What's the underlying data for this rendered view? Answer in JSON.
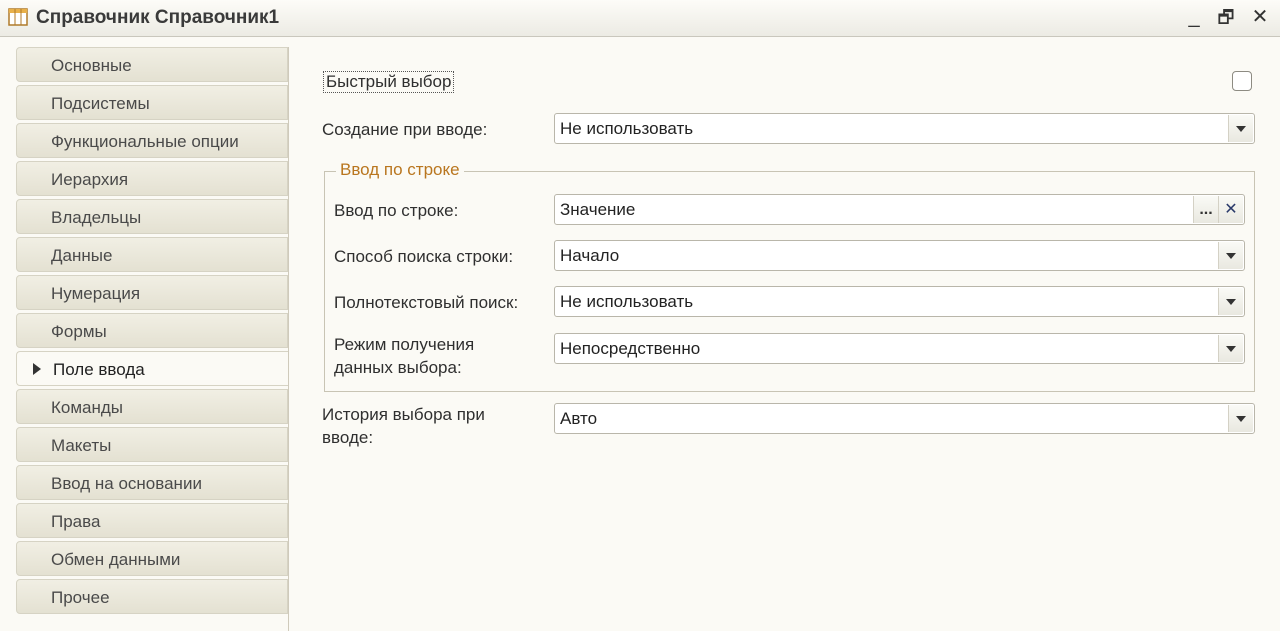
{
  "window": {
    "title": "Справочник Справочник1",
    "controls": {
      "minimize": "_",
      "restore": "🗗",
      "close": "✕"
    }
  },
  "tabs": [
    {
      "label": "Основные",
      "active": false
    },
    {
      "label": "Подсистемы",
      "active": false
    },
    {
      "label": "Функциональные опции",
      "active": false
    },
    {
      "label": "Иерархия",
      "active": false
    },
    {
      "label": "Владельцы",
      "active": false
    },
    {
      "label": "Данные",
      "active": false
    },
    {
      "label": "Нумерация",
      "active": false
    },
    {
      "label": "Формы",
      "active": false
    },
    {
      "label": "Поле ввода",
      "active": true
    },
    {
      "label": "Команды",
      "active": false
    },
    {
      "label": "Макеты",
      "active": false
    },
    {
      "label": "Ввод на основании",
      "active": false
    },
    {
      "label": "Права",
      "active": false
    },
    {
      "label": "Обмен данными",
      "active": false
    },
    {
      "label": "Прочее",
      "active": false
    }
  ],
  "form": {
    "quick_choice": {
      "label": "Быстрый выбор",
      "checked": false
    },
    "create_on_input": {
      "label": "Создание при вводе:",
      "value": "Не использовать"
    },
    "input_by_string_group": {
      "title": "Ввод по строке",
      "input_by_string": {
        "label": "Ввод по строке:",
        "value": "Значение",
        "select_btn": "...",
        "clear_btn": "✕"
      },
      "search_mode": {
        "label": "Способ поиска строки:",
        "value": "Начало"
      },
      "fulltext_search": {
        "label": "Полнотекстовый поиск:",
        "value": "Не использовать"
      },
      "choice_data_mode": {
        "label_line1": "Режим получения",
        "label_line2": "данных выбора:",
        "value": "Непосредственно"
      }
    },
    "choice_history": {
      "label_line1": "История выбора при",
      "label_line2": "вводе:",
      "value": "Авто"
    }
  },
  "colors": {
    "group_title": "#b9761f",
    "background": "#fbfaf5"
  }
}
